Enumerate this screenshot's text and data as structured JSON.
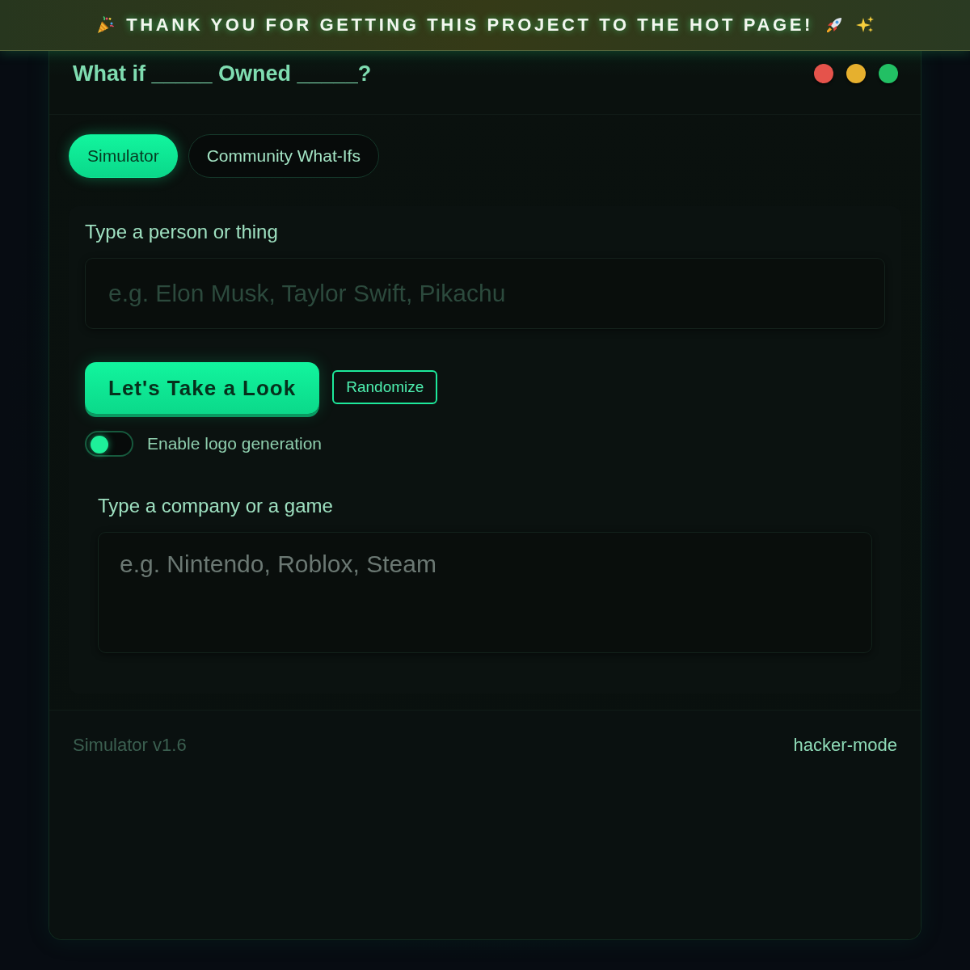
{
  "banner": {
    "text": "THANK YOU FOR GETTING THIS PROJECT TO THE HOT PAGE!"
  },
  "window": {
    "title": "What if _____ Owned _____?",
    "controls": [
      {
        "color": "#e5534b"
      },
      {
        "color": "#e6b02e"
      },
      {
        "color": "#22c064"
      }
    ]
  },
  "tabs": [
    {
      "label": "Simulator",
      "selected": true
    },
    {
      "label": "Community What-Ifs",
      "selected": false
    }
  ],
  "person_field": {
    "label": "Type a person or thing",
    "placeholder": "e.g. Elon Musk, Taylor Swift, Pikachu"
  },
  "actions": [
    {
      "label": "Let's Take a Look",
      "kind": "primary"
    },
    {
      "label": "Randomize",
      "kind": "outline"
    }
  ],
  "logo_toggle": {
    "label": "Enable logo generation",
    "on": false
  },
  "company_field": {
    "label": "Type a company or a game",
    "placeholder": "e.g. Nintendo, Roblox, Steam"
  },
  "footer": {
    "version": "Simulator v1.6",
    "mode": "hacker-mode"
  }
}
